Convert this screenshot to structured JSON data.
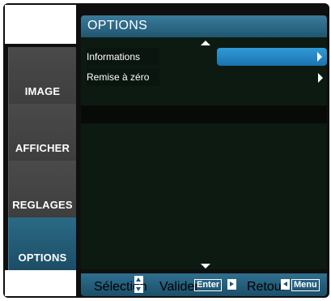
{
  "sidebar": {
    "items": [
      {
        "label": "IMAGE",
        "active": false
      },
      {
        "label": "AFFICHER",
        "active": false
      },
      {
        "label": "REGLAGES",
        "active": false
      },
      {
        "label": "OPTIONS",
        "active": true
      }
    ]
  },
  "header": {
    "title": "OPTIONS"
  },
  "menu": {
    "items": [
      {
        "label": "Informations",
        "selected": true
      },
      {
        "label": "Remise à zéro",
        "selected": false
      }
    ]
  },
  "footer": {
    "selection_label": "Sélection",
    "validate_label": "Valider",
    "enter_key": "Enter",
    "back_label": "Retour",
    "menu_key": "Menu"
  },
  "colors": {
    "accent": "#2f9ad6",
    "header": "#2b6a85",
    "background": "#0f0f0f"
  },
  "icons": [
    "scroll-up-arrow-icon",
    "scroll-down-arrow-icon",
    "submenu-arrow-icon",
    "up-down-icon",
    "right-arrow-key-icon",
    "left-arrow-key-icon"
  ]
}
